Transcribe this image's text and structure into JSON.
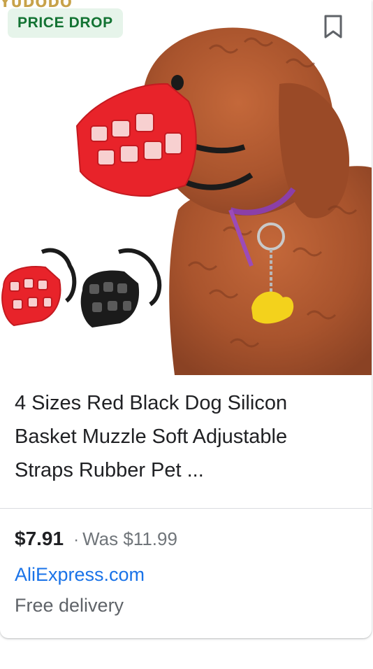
{
  "product": {
    "brand_fragment": "YUDODO",
    "badge": "PRICE DROP",
    "save_icon": "bookmark-icon",
    "image_subject": "dog-muzzle-product-photo",
    "title": "4 Sizes Red Black Dog Silicon Basket Muzzle Soft Adjustable Straps Rubber Pet ...",
    "price": "$7.91",
    "separator": "·",
    "was_price": "Was $11.99",
    "merchant": "AliExpress.com",
    "delivery": "Free delivery"
  },
  "colors": {
    "badge_bg": "#e6f4ea",
    "badge_text": "#137333",
    "link": "#1a73e8",
    "muted_text": "#70757a",
    "muzzle_red": "#e8232a",
    "muzzle_black": "#1b1b1b",
    "dog_fur": "#b0572e"
  }
}
